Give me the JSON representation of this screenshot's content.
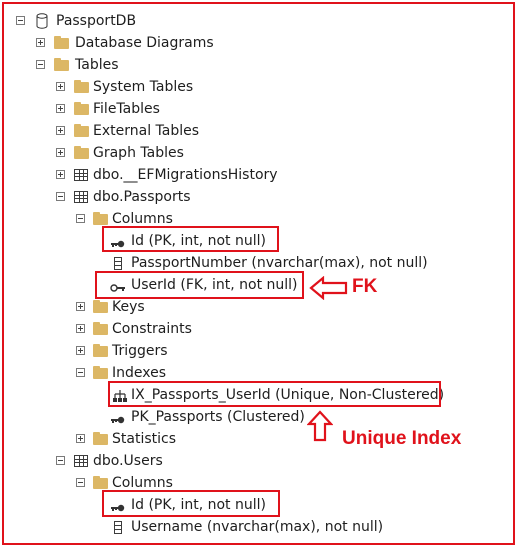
{
  "tree": {
    "root": "PassportDB",
    "database_diagrams": "Database Diagrams",
    "tables": "Tables",
    "system_tables": "System Tables",
    "file_tables": "FileTables",
    "external_tables": "External Tables",
    "graph_tables": "Graph Tables",
    "ef_history": "dbo.__EFMigrationsHistory",
    "passports": {
      "name": "dbo.Passports",
      "columns": "Columns",
      "id": "Id (PK, int, not null)",
      "passport_number": "PassportNumber (nvarchar(max), not null)",
      "user_id": "UserId (FK, int, not null)",
      "keys": "Keys",
      "constraints": "Constraints",
      "triggers": "Triggers",
      "indexes": "Indexes",
      "ix_passports_userid": "IX_Passports_UserId (Unique, Non-Clustered)",
      "pk_passports": "PK_Passports (Clustered)",
      "statistics": "Statistics"
    },
    "users": {
      "name": "dbo.Users",
      "columns": "Columns",
      "id": "Id (PK, int, not null)",
      "username": "Username (nvarchar(max), not null)"
    }
  },
  "annotations": {
    "fk": "FK",
    "unique_index": "Unique Index",
    "color": "#e0121b"
  },
  "icons": [
    "database-icon",
    "folder-icon",
    "table-icon",
    "key-icon",
    "fk-key-icon",
    "column-icon",
    "index-icon"
  ]
}
